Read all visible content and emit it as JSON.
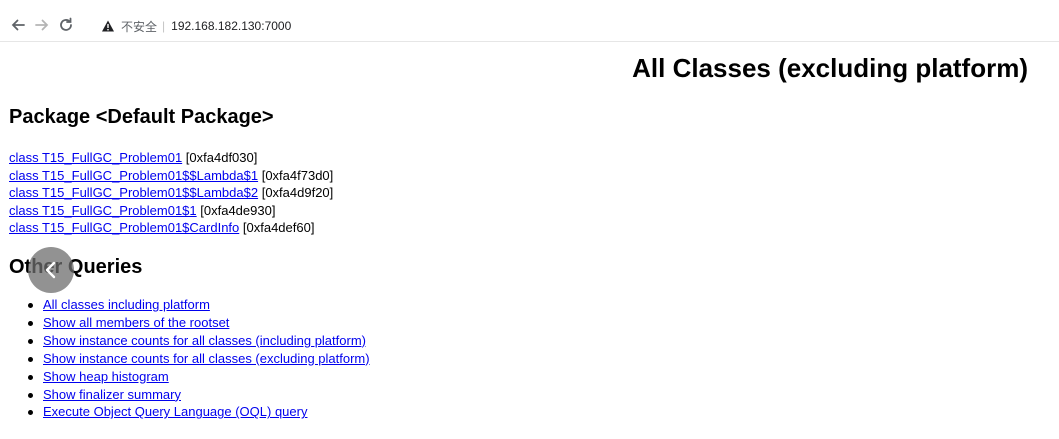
{
  "browser": {
    "back_icon": "arrow-left-icon",
    "forward_icon": "arrow-right-icon",
    "reload_icon": "reload-icon",
    "security_label": "不安全",
    "separator": "|",
    "url": "192.168.182.130:7000"
  },
  "page": {
    "title": "All Classes (excluding platform)",
    "package_heading": "Package <Default Package>",
    "classes": [
      {
        "label": "class T15_FullGC_Problem01",
        "address": "[0xfa4df030]"
      },
      {
        "label": "class T15_FullGC_Problem01$$Lambda$1",
        "address": "[0xfa4f73d0]"
      },
      {
        "label": "class T15_FullGC_Problem01$$Lambda$2",
        "address": "[0xfa4d9f20]"
      },
      {
        "label": "class T15_FullGC_Problem01$1",
        "address": "[0xfa4de930]"
      },
      {
        "label": "class T15_FullGC_Problem01$CardInfo",
        "address": "[0xfa4def60]"
      }
    ],
    "queries_heading": "Other Queries",
    "queries": [
      "All classes including platform",
      "Show all members of the rootset",
      "Show instance counts for all classes (including platform)",
      "Show instance counts for all classes (excluding platform)",
      "Show heap histogram",
      "Show finalizer summary",
      "Execute Object Query Language (OQL) query"
    ]
  },
  "colors": {
    "link": "#0000ee",
    "overlay": "#6e6e6e"
  }
}
